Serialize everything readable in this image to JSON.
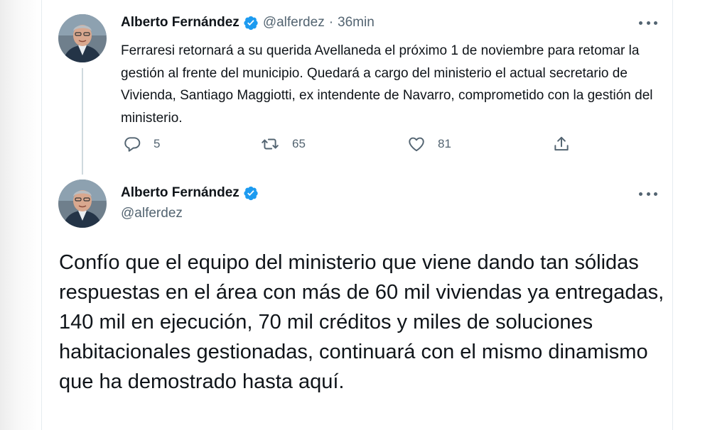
{
  "tweet1": {
    "display_name": "Alberto Fernández",
    "handle": "@alferdez",
    "separator": "·",
    "time": "36min",
    "text": "Ferraresi retornará a su querida Avellaneda el próximo 1 de noviembre para retomar la gestión al frente del municipio. Quedará a cargo del ministerio el actual secretario de Vivienda, Santiago Maggiotti, ex intendente de Navarro, comprometido con la gestión del ministerio.",
    "actions": {
      "replies": "5",
      "retweets": "65",
      "likes": "81"
    }
  },
  "tweet2": {
    "display_name": "Alberto Fernández",
    "handle": "@alferdez",
    "text": "Confío que el equipo del ministerio que viene dando tan sólidas respuestas en el área con más de 60 mil viviendas ya entregadas, 140 mil en ejecución, 70 mil créditos y miles de soluciones habitacionales gestionadas, continuará con el mismo dinamismo que ha demostrado hasta aquí."
  },
  "icons": {
    "verified": "verified-badge-icon",
    "more": "more-options-icon",
    "reply": "reply-icon",
    "retweet": "retweet-icon",
    "like": "like-icon",
    "share": "share-icon"
  },
  "colors": {
    "text_primary": "#0f1419",
    "text_secondary": "#536471",
    "verified_blue": "#1d9bf0",
    "thread_line": "#cfd9de"
  }
}
